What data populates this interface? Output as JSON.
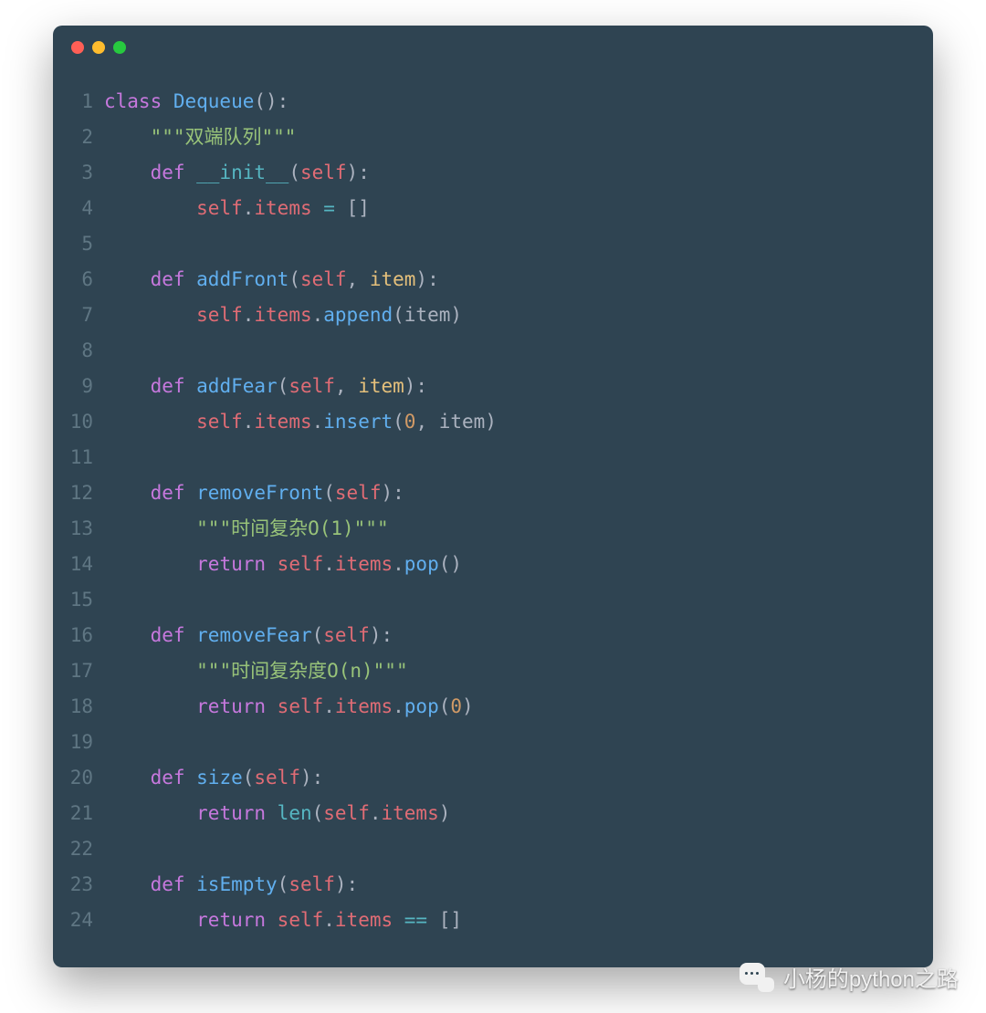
{
  "code": {
    "lines": [
      {
        "n": "1",
        "tokens": [
          [
            "k",
            "class "
          ],
          [
            "cls",
            "Dequeue"
          ],
          [
            "p",
            "():"
          ]
        ]
      },
      {
        "n": "2",
        "tokens": [
          [
            "tx",
            "    "
          ],
          [
            "str",
            "\"\"\"双端队列\"\"\""
          ]
        ]
      },
      {
        "n": "3",
        "tokens": [
          [
            "tx",
            "    "
          ],
          [
            "k",
            "def "
          ],
          [
            "sp",
            "__init__"
          ],
          [
            "p",
            "("
          ],
          [
            "slf",
            "self"
          ],
          [
            "p",
            "):"
          ]
        ]
      },
      {
        "n": "4",
        "tokens": [
          [
            "tx",
            "        "
          ],
          [
            "slf",
            "self"
          ],
          [
            "p",
            "."
          ],
          [
            "id",
            "items"
          ],
          [
            "tx",
            " "
          ],
          [
            "op",
            "="
          ],
          [
            "tx",
            " []"
          ]
        ]
      },
      {
        "n": "5",
        "tokens": [
          [
            "tx",
            ""
          ]
        ]
      },
      {
        "n": "6",
        "tokens": [
          [
            "tx",
            "    "
          ],
          [
            "k",
            "def "
          ],
          [
            "fn",
            "addFront"
          ],
          [
            "p",
            "("
          ],
          [
            "slf",
            "self"
          ],
          [
            "p",
            ", "
          ],
          [
            "par",
            "item"
          ],
          [
            "p",
            "):"
          ]
        ]
      },
      {
        "n": "7",
        "tokens": [
          [
            "tx",
            "        "
          ],
          [
            "slf",
            "self"
          ],
          [
            "p",
            "."
          ],
          [
            "id",
            "items"
          ],
          [
            "p",
            "."
          ],
          [
            "fn",
            "append"
          ],
          [
            "p",
            "("
          ],
          [
            "tx",
            "item"
          ],
          [
            "p",
            ")"
          ]
        ]
      },
      {
        "n": "8",
        "tokens": [
          [
            "tx",
            ""
          ]
        ]
      },
      {
        "n": "9",
        "tokens": [
          [
            "tx",
            "    "
          ],
          [
            "k",
            "def "
          ],
          [
            "fn",
            "addFear"
          ],
          [
            "p",
            "("
          ],
          [
            "slf",
            "self"
          ],
          [
            "p",
            ", "
          ],
          [
            "par",
            "item"
          ],
          [
            "p",
            "):"
          ]
        ]
      },
      {
        "n": "10",
        "tokens": [
          [
            "tx",
            "        "
          ],
          [
            "slf",
            "self"
          ],
          [
            "p",
            "."
          ],
          [
            "id",
            "items"
          ],
          [
            "p",
            "."
          ],
          [
            "fn",
            "insert"
          ],
          [
            "p",
            "("
          ],
          [
            "num",
            "0"
          ],
          [
            "p",
            ", "
          ],
          [
            "tx",
            "item"
          ],
          [
            "p",
            ")"
          ]
        ]
      },
      {
        "n": "11",
        "tokens": [
          [
            "tx",
            ""
          ]
        ]
      },
      {
        "n": "12",
        "tokens": [
          [
            "tx",
            "    "
          ],
          [
            "k",
            "def "
          ],
          [
            "fn",
            "removeFront"
          ],
          [
            "p",
            "("
          ],
          [
            "slf",
            "self"
          ],
          [
            "p",
            "):"
          ]
        ]
      },
      {
        "n": "13",
        "tokens": [
          [
            "tx",
            "        "
          ],
          [
            "str",
            "\"\"\"时间复杂O(1)\"\"\""
          ]
        ]
      },
      {
        "n": "14",
        "tokens": [
          [
            "tx",
            "        "
          ],
          [
            "k",
            "return "
          ],
          [
            "slf",
            "self"
          ],
          [
            "p",
            "."
          ],
          [
            "id",
            "items"
          ],
          [
            "p",
            "."
          ],
          [
            "fn",
            "pop"
          ],
          [
            "p",
            "()"
          ]
        ]
      },
      {
        "n": "15",
        "tokens": [
          [
            "tx",
            ""
          ]
        ]
      },
      {
        "n": "16",
        "tokens": [
          [
            "tx",
            "    "
          ],
          [
            "k",
            "def "
          ],
          [
            "fn",
            "removeFear"
          ],
          [
            "p",
            "("
          ],
          [
            "slf",
            "self"
          ],
          [
            "p",
            "):"
          ]
        ]
      },
      {
        "n": "17",
        "tokens": [
          [
            "tx",
            "        "
          ],
          [
            "str",
            "\"\"\"时间复杂度O(n)\"\"\""
          ]
        ]
      },
      {
        "n": "18",
        "tokens": [
          [
            "tx",
            "        "
          ],
          [
            "k",
            "return "
          ],
          [
            "slf",
            "self"
          ],
          [
            "p",
            "."
          ],
          [
            "id",
            "items"
          ],
          [
            "p",
            "."
          ],
          [
            "fn",
            "pop"
          ],
          [
            "p",
            "("
          ],
          [
            "num",
            "0"
          ],
          [
            "p",
            ")"
          ]
        ]
      },
      {
        "n": "19",
        "tokens": [
          [
            "tx",
            ""
          ]
        ]
      },
      {
        "n": "20",
        "tokens": [
          [
            "tx",
            "    "
          ],
          [
            "k",
            "def "
          ],
          [
            "fn",
            "size"
          ],
          [
            "p",
            "("
          ],
          [
            "slf",
            "self"
          ],
          [
            "p",
            "):"
          ]
        ]
      },
      {
        "n": "21",
        "tokens": [
          [
            "tx",
            "        "
          ],
          [
            "k",
            "return "
          ],
          [
            "bi",
            "len"
          ],
          [
            "p",
            "("
          ],
          [
            "slf",
            "self"
          ],
          [
            "p",
            "."
          ],
          [
            "id",
            "items"
          ],
          [
            "p",
            ")"
          ]
        ]
      },
      {
        "n": "22",
        "tokens": [
          [
            "tx",
            ""
          ]
        ]
      },
      {
        "n": "23",
        "tokens": [
          [
            "tx",
            "    "
          ],
          [
            "k",
            "def "
          ],
          [
            "fn",
            "isEmpty"
          ],
          [
            "p",
            "("
          ],
          [
            "slf",
            "self"
          ],
          [
            "p",
            "):"
          ]
        ]
      },
      {
        "n": "24",
        "tokens": [
          [
            "tx",
            "        "
          ],
          [
            "k",
            "return "
          ],
          [
            "slf",
            "self"
          ],
          [
            "p",
            "."
          ],
          [
            "id",
            "items"
          ],
          [
            "tx",
            " "
          ],
          [
            "op",
            "=="
          ],
          [
            "tx",
            " []"
          ]
        ]
      }
    ]
  },
  "watermark": {
    "text": "小杨的python之路"
  }
}
